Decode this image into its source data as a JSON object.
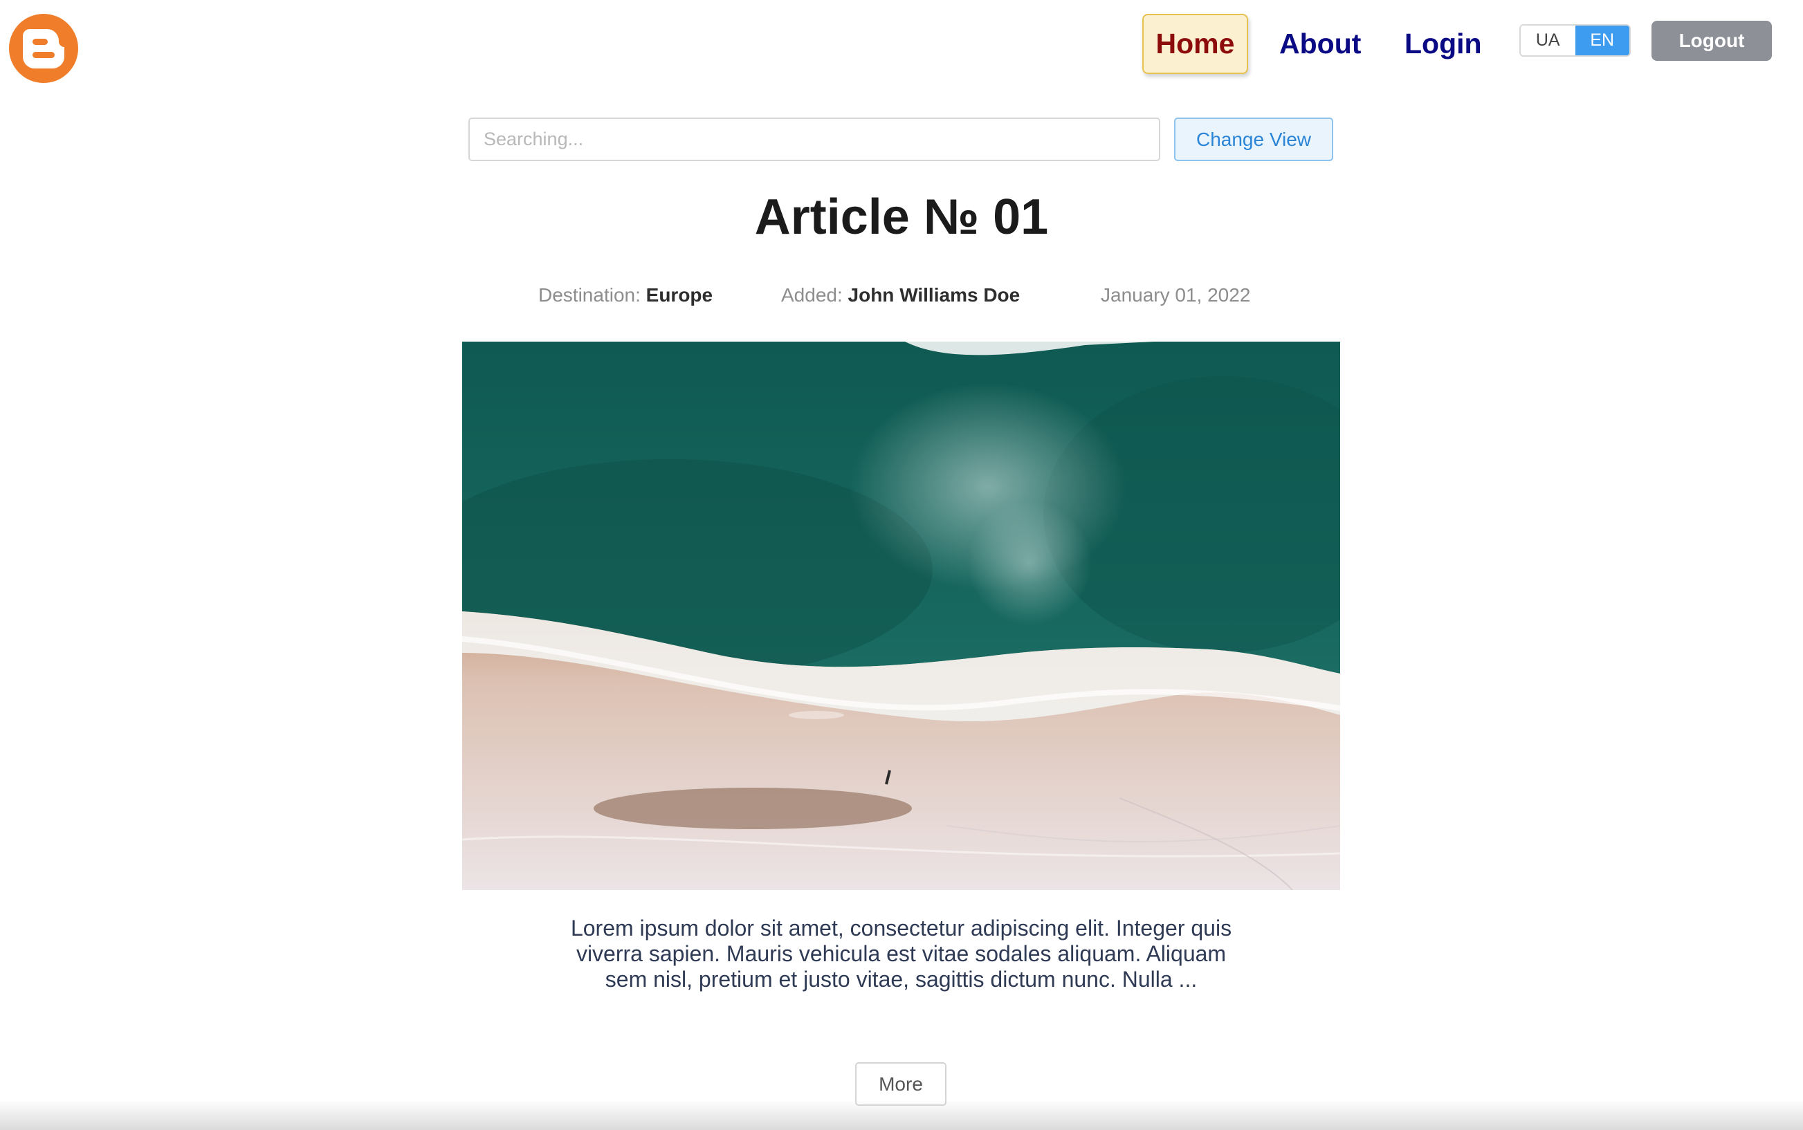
{
  "header": {
    "logo_icon": "blogger-logo-icon",
    "nav": {
      "home": "Home",
      "about": "About",
      "login": "Login"
    },
    "language": {
      "options": [
        "UA",
        "EN"
      ],
      "selected": "EN"
    },
    "logout_label": "Logout"
  },
  "search": {
    "placeholder": "Searching...",
    "value": "",
    "change_view_label": "Change View"
  },
  "article": {
    "title": "Article № 01",
    "destination_label": "Destination:",
    "destination_value": "Europe",
    "added_label": "Added:",
    "added_value": "John Williams Doe",
    "date": "January 01, 2022",
    "image_icon": "beach-aerial-photo",
    "excerpt": "Lorem ipsum dolor sit amet, consectetur adipiscing elit. Integer quis viverra sapien. Mauris vehicula est vitae sodales aliquam. Aliquam sem nisl, pretium et justo vitae, sagittis dictum nunc. Nulla ...",
    "more_label": "More"
  },
  "colors": {
    "accent_blue": "#3d9bf0",
    "nav_blue": "#0a0a84",
    "home_red": "#8c0b0b",
    "logo_orange": "#f07d2a"
  }
}
